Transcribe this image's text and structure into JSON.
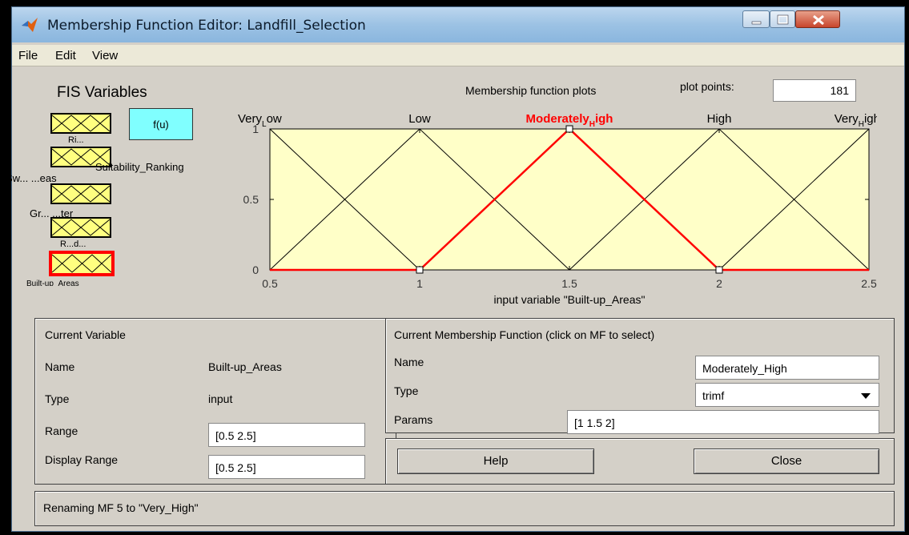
{
  "window": {
    "title": "Membership Function Editor: Landfill_Selection"
  },
  "menu": [
    "File",
    "Edit",
    "View"
  ],
  "fis": {
    "label": "FIS Variables",
    "inputs": [
      {
        "name": "Ri..."
      },
      {
        "name": "Sw... ...eas"
      },
      {
        "name": "Gr... ...ter"
      },
      {
        "name": "R...d..."
      },
      {
        "name": "Built-up_Areas"
      }
    ],
    "output": {
      "box_label": "f(u)",
      "name": "Suitability_Ranking"
    }
  },
  "plot": {
    "title": "Membership function plots",
    "plot_points_label": "plot points:",
    "plot_points_value": "181",
    "xlabel": "input variable \"Built-up_Areas\""
  },
  "chart_data": {
    "type": "line",
    "xlim": [
      0.5,
      2.5
    ],
    "ylim": [
      0,
      1
    ],
    "xticks": [
      "0.5",
      "1",
      "1.5",
      "2",
      "2.5"
    ],
    "yticks": [
      "0",
      "0.5",
      "1"
    ],
    "selected": "Moderately_High",
    "selected_color": "#ff0000",
    "line_color": "#000000",
    "background": "#ffffc8",
    "series": [
      {
        "name": "Very_Low",
        "x": [
          0.5,
          1.0
        ],
        "y": [
          1,
          0
        ]
      },
      {
        "name": "Low",
        "x": [
          0.5,
          1.0,
          1.5
        ],
        "y": [
          0,
          1,
          0
        ]
      },
      {
        "name": "Moderately_High",
        "x": [
          0.5,
          1.0,
          1.5,
          2.0,
          2.5
        ],
        "y": [
          0,
          0,
          1,
          0,
          0
        ]
      },
      {
        "name": "High",
        "x": [
          1.5,
          2.0,
          2.5
        ],
        "y": [
          0,
          1,
          0
        ]
      },
      {
        "name": "Very_High",
        "x": [
          2.0,
          2.5
        ],
        "y": [
          0,
          1
        ]
      }
    ],
    "labels": [
      {
        "base": "Very",
        "sub": "L",
        "rest": "ow",
        "x": 0.5
      },
      {
        "base": "Low",
        "sub": "",
        "rest": "",
        "x": 1.0
      },
      {
        "base": "Moderately",
        "sub": "H",
        "rest": "igh",
        "x": 1.5
      },
      {
        "base": "High",
        "sub": "",
        "rest": "",
        "x": 2.0
      },
      {
        "base": "Very",
        "sub": "H",
        "rest": "igh",
        "x": 2.5
      }
    ]
  },
  "current_variable": {
    "heading": "Current Variable",
    "name_label": "Name",
    "name_value": "Built-up_Areas",
    "type_label": "Type",
    "type_value": "input",
    "range_label": "Range",
    "range_value": "[0.5 2.5]",
    "display_range_label": "Display Range",
    "display_range_value": "[0.5 2.5]"
  },
  "current_mf": {
    "heading": "Current Membership Function (click on MF to select)",
    "name_label": "Name",
    "name_value": "Moderately_High",
    "type_label": "Type",
    "type_value": "trimf",
    "params_label": "Params",
    "params_value": "[1 1.5 2]"
  },
  "buttons": {
    "help": "Help",
    "close": "Close"
  },
  "status": "Renaming MF 5 to \"Very_High\""
}
